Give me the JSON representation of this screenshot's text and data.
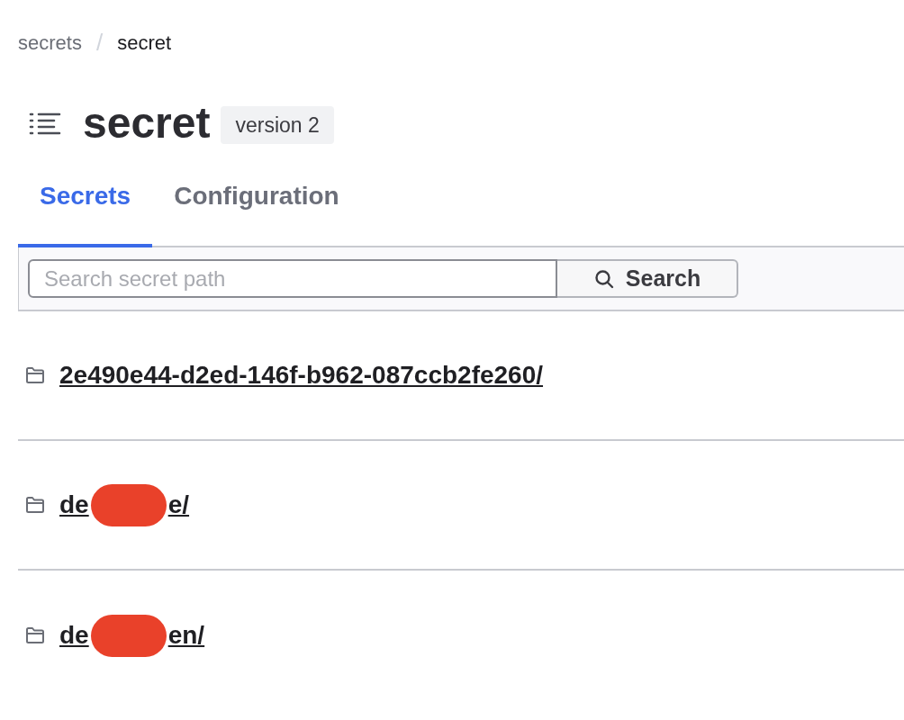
{
  "breadcrumb": [
    {
      "label": "secrets",
      "current": false
    },
    {
      "label": "secret",
      "current": true
    }
  ],
  "breadcrumb_separator": "/",
  "title": "secret",
  "badge": "version 2",
  "tabs": [
    {
      "label": "Secrets",
      "selected": true
    },
    {
      "label": "Configuration",
      "selected": false
    }
  ],
  "search": {
    "placeholder": "Search secret path",
    "button": "Search"
  },
  "folders": [
    {
      "segments": [
        "2e490e44-d2ed-146f-b962-087ccb2fe260/"
      ],
      "redacted": false
    },
    {
      "segments": [
        "de",
        "e/"
      ],
      "redacted": true
    },
    {
      "segments": [
        "de",
        "en/"
      ],
      "redacted": true
    }
  ]
}
